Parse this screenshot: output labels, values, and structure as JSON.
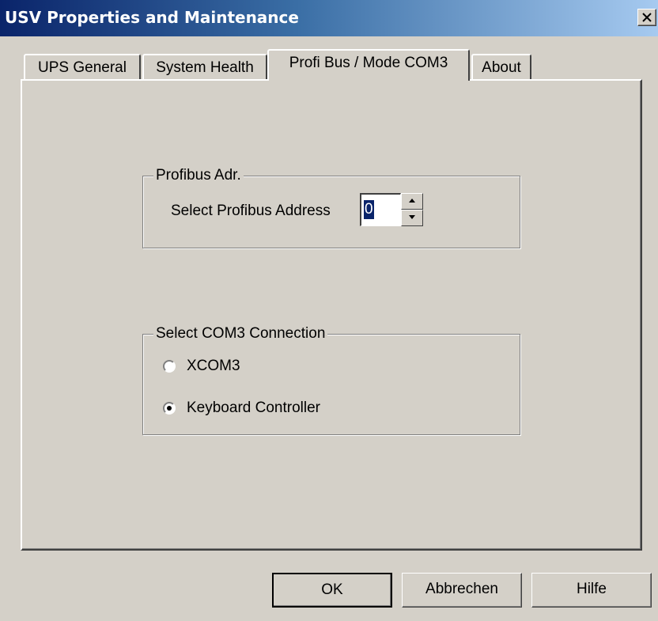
{
  "window": {
    "title": "USV Properties and Maintenance"
  },
  "tabs": [
    {
      "label": "UPS General",
      "active": false
    },
    {
      "label": "System Health",
      "active": false
    },
    {
      "label": "Profi Bus / Mode COM3",
      "active": true
    },
    {
      "label": "About",
      "active": false
    }
  ],
  "profibus_group": {
    "title": "Profibus Adr.",
    "address_label": "Select Profibus Address",
    "address_value": "0"
  },
  "com3_group": {
    "title": "Select COM3 Connection",
    "options": [
      {
        "label": "XCOM3",
        "selected": false
      },
      {
        "label": "Keyboard Controller",
        "selected": true
      }
    ]
  },
  "buttons": {
    "ok": "OK",
    "cancel": "Abbrechen",
    "help": "Hilfe"
  }
}
